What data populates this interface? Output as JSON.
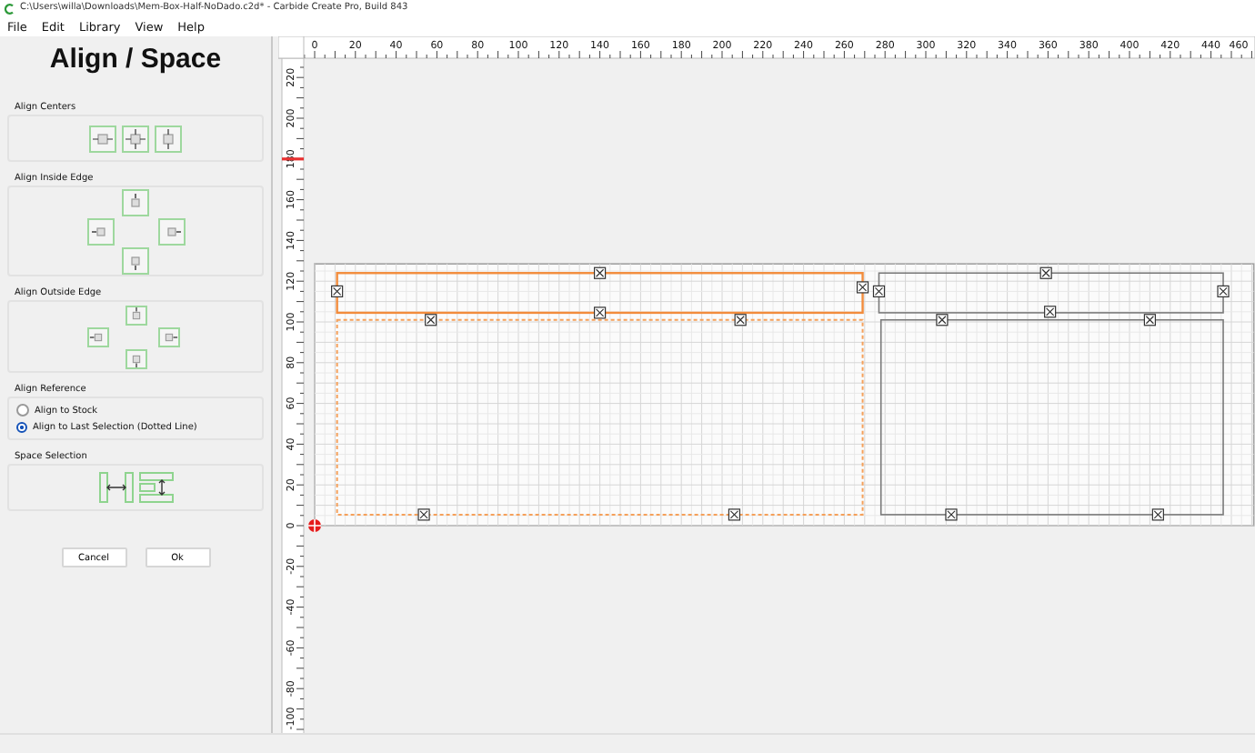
{
  "window": {
    "title": "C:\\Users\\willa\\Downloads\\Mem-Box-Half-NoDado.c2d* - Carbide Create Pro, Build 843"
  },
  "menu": [
    "File",
    "Edit",
    "Library",
    "View",
    "Help"
  ],
  "panel": {
    "title": "Align / Space",
    "groups": [
      {
        "label": "Align Centers",
        "kind": "centers"
      },
      {
        "label": "Align Inside Edge",
        "kind": "inside"
      },
      {
        "label": "Align Outside Edge",
        "kind": "outside"
      }
    ],
    "reference": {
      "label": "Align Reference",
      "options": [
        {
          "label": "Align to Stock",
          "selected": false
        },
        {
          "label": "Align to Last Selection (Dotted Line)",
          "selected": true
        }
      ]
    },
    "spacing": {
      "label": "Space Selection"
    },
    "buttons": [
      "Cancel",
      "Ok"
    ]
  },
  "canvas": {
    "x_ticks": [
      "0",
      "20",
      "40",
      "60",
      "80",
      "100",
      "120",
      "140",
      "160",
      "180",
      "200",
      "220",
      "240",
      "260",
      "280",
      "300",
      "320",
      "340",
      "360",
      "380",
      "400",
      "420",
      "440",
      "460"
    ],
    "y_ticks": [
      "220",
      "200",
      "180",
      "160",
      "140",
      "120",
      "100",
      "80",
      "60",
      "40",
      "20",
      "0",
      "-20",
      "-40",
      "-60",
      "-80",
      "-100"
    ],
    "shapes": [
      {
        "kind": "selected"
      },
      {
        "kind": "reference"
      },
      {
        "kind": "plain"
      },
      {
        "kind": "plain"
      }
    ]
  }
}
